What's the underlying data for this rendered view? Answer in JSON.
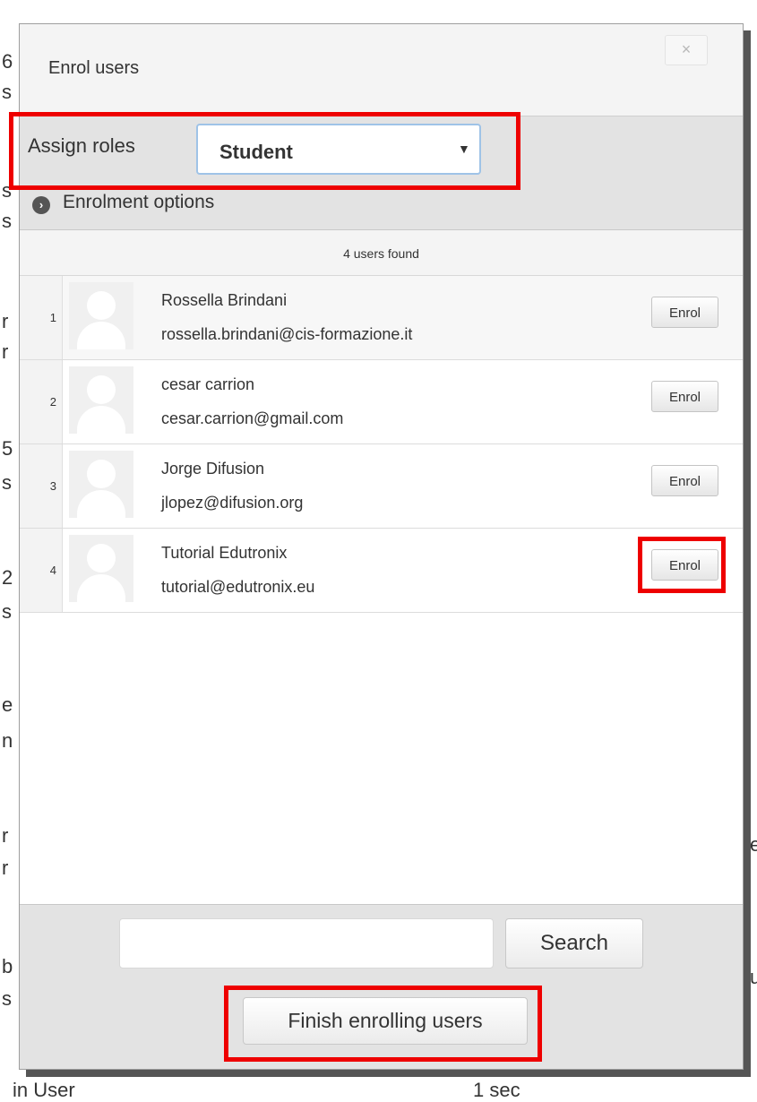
{
  "background": {
    "left_fragments": [
      "6",
      "s",
      "s",
      "s",
      "r",
      "r",
      "5",
      "s",
      "2",
      "s",
      "e",
      "n",
      "r",
      "r",
      "b",
      "s"
    ],
    "right_fragments": [
      "e",
      "u"
    ],
    "bottom_left": "in User",
    "bottom_right": "1 sec"
  },
  "modal": {
    "title": "Enrol users",
    "close_label": "×",
    "roles": {
      "label": "Assign roles",
      "selected": "Student",
      "arrow": "▼"
    },
    "enrolment_options": {
      "icon": "chevron-right-icon",
      "glyph": "›",
      "label": "Enrolment options"
    },
    "users_found": "4 users found",
    "users": [
      {
        "num": "1",
        "name": "Rossella Brindani",
        "email": "rossella.brindani@cis-formazione.it",
        "action": "Enrol"
      },
      {
        "num": "2",
        "name": "cesar carrion",
        "email": "cesar.carrion@gmail.com",
        "action": "Enrol"
      },
      {
        "num": "3",
        "name": "Jorge Difusion",
        "email": "jlopez@difusion.org",
        "action": "Enrol"
      },
      {
        "num": "4",
        "name": "Tutorial Edutronix",
        "email": "tutorial@edutronix.eu",
        "action": "Enrol"
      }
    ],
    "search": {
      "value": "",
      "placeholder": "",
      "button": "Search"
    },
    "finish_button": "Finish enrolling users"
  },
  "colors": {
    "highlight": "#ee0000",
    "select_border": "#9fc3e7",
    "panel_grey": "#e3e3e3"
  }
}
